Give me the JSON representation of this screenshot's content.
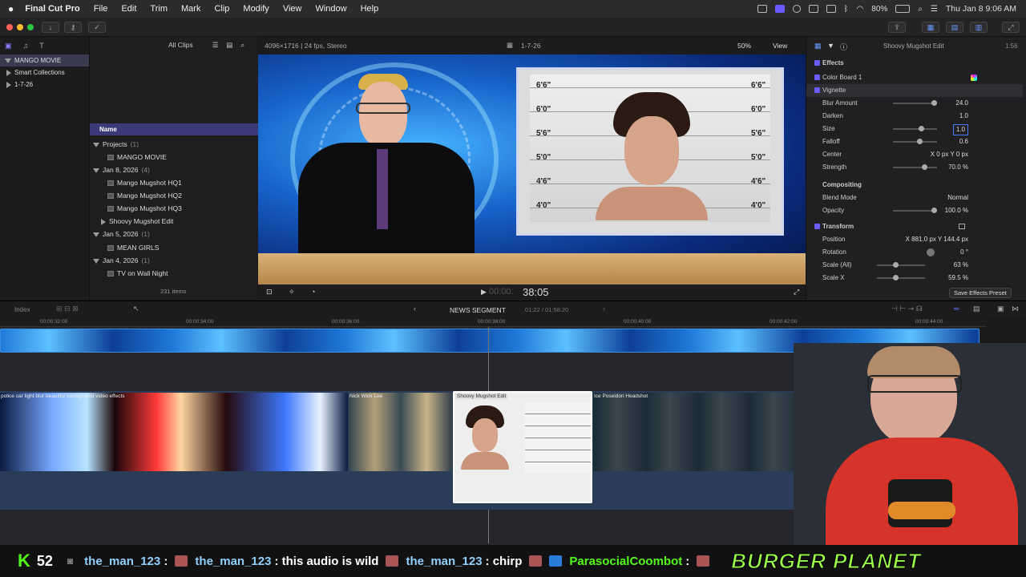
{
  "menubar": {
    "app": "Final Cut Pro",
    "items": [
      "File",
      "Edit",
      "Trim",
      "Mark",
      "Clip",
      "Modify",
      "View",
      "Window",
      "Help"
    ],
    "battery": "80%",
    "clock": "Thu Jan 8  9:06 AM"
  },
  "libraries": {
    "items": [
      {
        "label": "MANGO MOVIE"
      },
      {
        "label": "Smart Collections"
      },
      {
        "label": "1-7-26"
      }
    ]
  },
  "browser": {
    "filter": "All Clips",
    "column": "Name",
    "item_count": "231 items",
    "rows": [
      {
        "label": "Projects",
        "count": "(1)"
      },
      {
        "label": "MANGO MOVIE",
        "count": ""
      },
      {
        "label": "Jan 8, 2026",
        "count": "(4)"
      },
      {
        "label": "Mango Mugshot HQ1",
        "count": ""
      },
      {
        "label": "Mango Mugshot HQ2",
        "count": ""
      },
      {
        "label": "Mango Mugshot HQ3",
        "count": ""
      },
      {
        "label": "Shoovy Mugshot Edit",
        "count": ""
      },
      {
        "label": "Jan 5, 2026",
        "count": "(1)"
      },
      {
        "label": "MEAN GIRLS",
        "count": ""
      },
      {
        "label": "Jan 4, 2026",
        "count": "(1)"
      },
      {
        "label": "TV on Wall Night",
        "count": ""
      }
    ]
  },
  "viewer": {
    "format": "4096×1716 | 24 fps, Stereo",
    "event": "1-7-26",
    "zoom": "50%",
    "view_menu": "View",
    "timecode": "38:05",
    "timecode_prefix": "00:00:",
    "mugshot_heights": [
      "6'6\"",
      "6'0\"",
      "5'6\"",
      "5'0\"",
      "4'6\"",
      "4'0\""
    ]
  },
  "inspector": {
    "clip_name": "Shoovy Mugshot Edit",
    "duration": "1:56",
    "effects_header": "Effects",
    "color_board": "Color Board 1",
    "vignette": "Vignette",
    "params": [
      {
        "label": "Blur Amount",
        "value": "24.0"
      },
      {
        "label": "Darken",
        "value": "1.0"
      },
      {
        "label": "Size",
        "value": "1.0"
      },
      {
        "label": "Falloff",
        "value": "0.6"
      },
      {
        "label": "Center",
        "value": "X    0 px   Y    0 px"
      },
      {
        "label": "Strength",
        "value": "70.0 %"
      }
    ],
    "compositing": "Compositing",
    "blend_mode_label": "Blend Mode",
    "blend_mode": "Normal",
    "opacity_label": "Opacity",
    "opacity": "100.0 %",
    "transform": "Transform",
    "transform_params": [
      {
        "label": "Position",
        "value": "X  881.0 px   Y  144.4 px"
      },
      {
        "label": "Rotation",
        "value": "0 °"
      },
      {
        "label": "Scale (All)",
        "value": "63 %"
      },
      {
        "label": "Scale X",
        "value": "59.5 %"
      }
    ],
    "save_preset": "Save Effects Preset"
  },
  "timeline": {
    "index_label": "Index",
    "project": "NEWS SEGMENT",
    "position": "01:22 / 01:58:20",
    "ruler": [
      "00:00:32:00",
      "00:00:34:00",
      "00:00:36:00",
      "00:00:38:00",
      "00:00:40:00",
      "00:00:42:00",
      "00:00:44:00"
    ],
    "clips": [
      {
        "label": "police car light blur beautiful background video effects"
      },
      {
        "label": "Nick Wick Lee"
      },
      {
        "label": "Shoovy Mugshot Edit"
      },
      {
        "label": "Ice Poseidon Headshot"
      }
    ]
  },
  "chat": {
    "count": "52",
    "messages": [
      {
        "user": "the_man_123",
        "text": ""
      },
      {
        "user": "the_man_123",
        "text": ": this audio is wild"
      },
      {
        "user": "the_man_123",
        "text": ": chirp"
      },
      {
        "user": "ParasocialCoombot",
        "text": ":"
      }
    ],
    "sponsor": "BURGER PLANET"
  },
  "colors": {
    "accent": "#6a5cff",
    "selection": "#3b3a78",
    "sponsor": "#9cff4a"
  }
}
